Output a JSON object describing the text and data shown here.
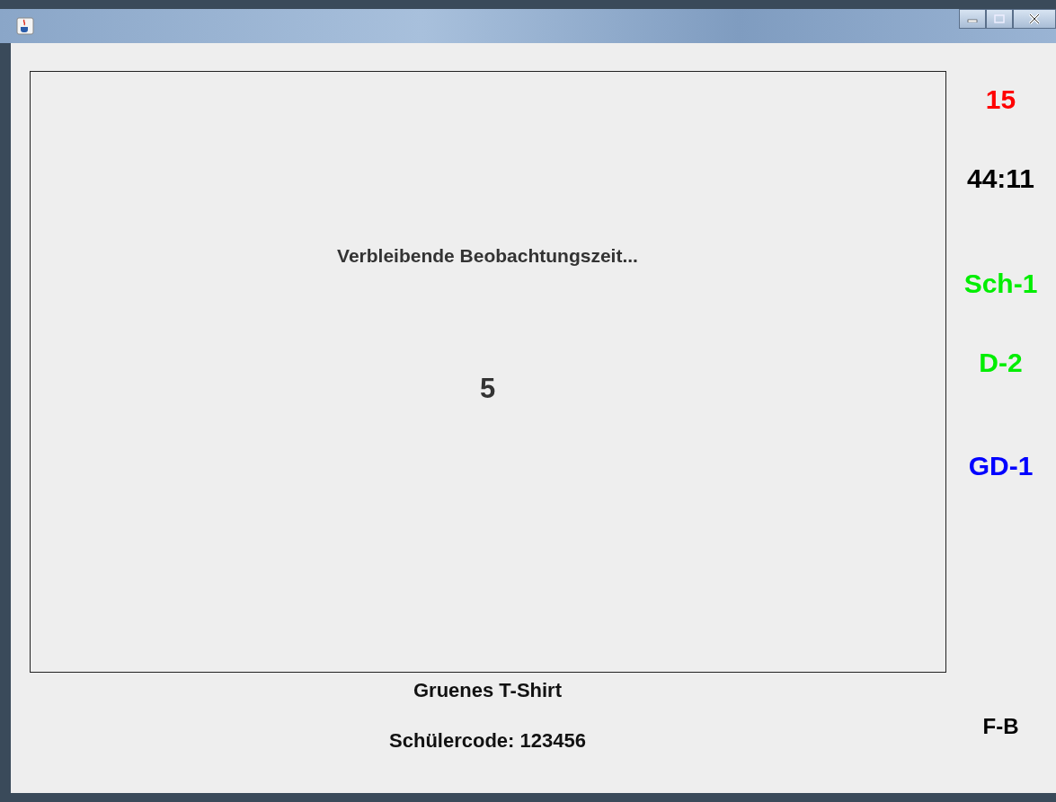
{
  "panel": {
    "message": "Verbleibende Beobachtungszeit...",
    "countdown": "5"
  },
  "shirt_label": "Gruenes T-Shirt",
  "student_code": "Schülercode: 123456",
  "sidebar": [
    {
      "text": "15",
      "color": "#ff0000"
    },
    {
      "text": "44:11",
      "color": "#000000"
    },
    {
      "text": "Sch-1",
      "color": "#00ee00"
    },
    {
      "text": "D-2",
      "color": "#00ee00"
    },
    {
      "text": "GD-1",
      "color": "#0000ff"
    }
  ],
  "corner_label": "F-B"
}
